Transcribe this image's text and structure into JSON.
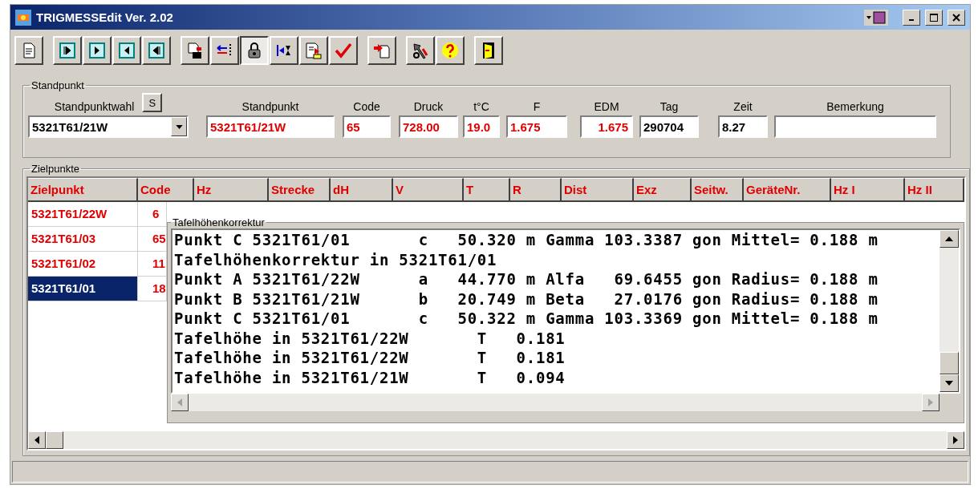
{
  "window": {
    "title": "TRIGMESSEdit Ver. 2.02"
  },
  "toolbar": {
    "buttons": [
      {
        "pressed": false
      },
      {
        "pressed": false
      },
      {
        "pressed": false
      },
      {
        "pressed": false
      },
      {
        "pressed": false
      },
      {
        "pressed": false
      },
      {
        "pressed": false
      },
      {
        "pressed": true
      },
      {
        "pressed": false
      },
      {
        "pressed": false
      },
      {
        "pressed": false
      },
      {
        "pressed": false
      },
      {
        "pressed": false
      },
      {
        "pressed": false
      },
      {
        "pressed": false
      }
    ]
  },
  "standpunkt": {
    "title": "Standpunkt",
    "fields": [
      {
        "kind": "combo",
        "label": "Standpunktwahl",
        "button": "S",
        "value": "5321T61/21W",
        "color": "#000000"
      },
      {
        "kind": "text",
        "label": "Standpunkt",
        "value": "5321T61/21W",
        "color": "#e00000"
      },
      {
        "kind": "text",
        "label": "Code",
        "value": "65",
        "color": "#e00000"
      },
      {
        "kind": "text",
        "label": "Druck",
        "value": "728.00",
        "color": "#e00000"
      },
      {
        "kind": "text",
        "label": "t°C",
        "value": "19.0",
        "color": "#e00000"
      },
      {
        "kind": "text",
        "label": "F",
        "value": "1.675",
        "color": "#e00000"
      },
      {
        "kind": "text",
        "label": "EDM",
        "value": "1.675",
        "color": "#e00000"
      },
      {
        "kind": "text",
        "label": "Tag",
        "value": "290704",
        "color": "#000000"
      },
      {
        "kind": "text",
        "label": "Zeit",
        "value": "8.27",
        "color": "#000000"
      },
      {
        "kind": "text",
        "label": "Bemerkung"
      }
    ]
  },
  "zielpunkte": {
    "title": "Zielpunkte",
    "columns": [
      "Zielpunkt",
      "Code",
      "Hz",
      "Strecke",
      "dH",
      "V",
      "T",
      "R",
      "Dist",
      "Exz",
      "Seitw.",
      "GeräteNr.",
      "Hz I",
      "Hz II"
    ],
    "rows": [
      {
        "cells": [
          "5321T61/22W",
          "6"
        ],
        "selected": false
      },
      {
        "cells": [
          "5321T61/03",
          "65"
        ],
        "selected": false
      },
      {
        "cells": [
          "5321T61/02",
          "11"
        ],
        "selected": false
      },
      {
        "cells": [
          "5321T61/01",
          "18"
        ],
        "selected": true
      }
    ]
  },
  "dialog": {
    "title": "Tafelhöhenkorrektur",
    "lines": [
      "Punkt C 5321T61/01       c   50.320 m Gamma 103.3387 gon Mittel= 0.188 m",
      "Tafelhöhenkorrektur in 5321T61/01",
      "Punkt A 5321T61/22W      a   44.770 m Alfa   69.6455 gon Radius= 0.188 m",
      "Punkt B 5321T61/21W      b   20.749 m Beta   27.0176 gon Radius= 0.188 m",
      "Punkt C 5321T61/01       c   50.322 m Gamma 103.3369 gon Mittel= 0.188 m",
      "Tafelhöhe in 5321T61/22W       T   0.181",
      "Tafelhöhe in 5321T61/22W       T   0.181",
      "Tafelhöhe in 5321T61/21W       T   0.094"
    ]
  }
}
